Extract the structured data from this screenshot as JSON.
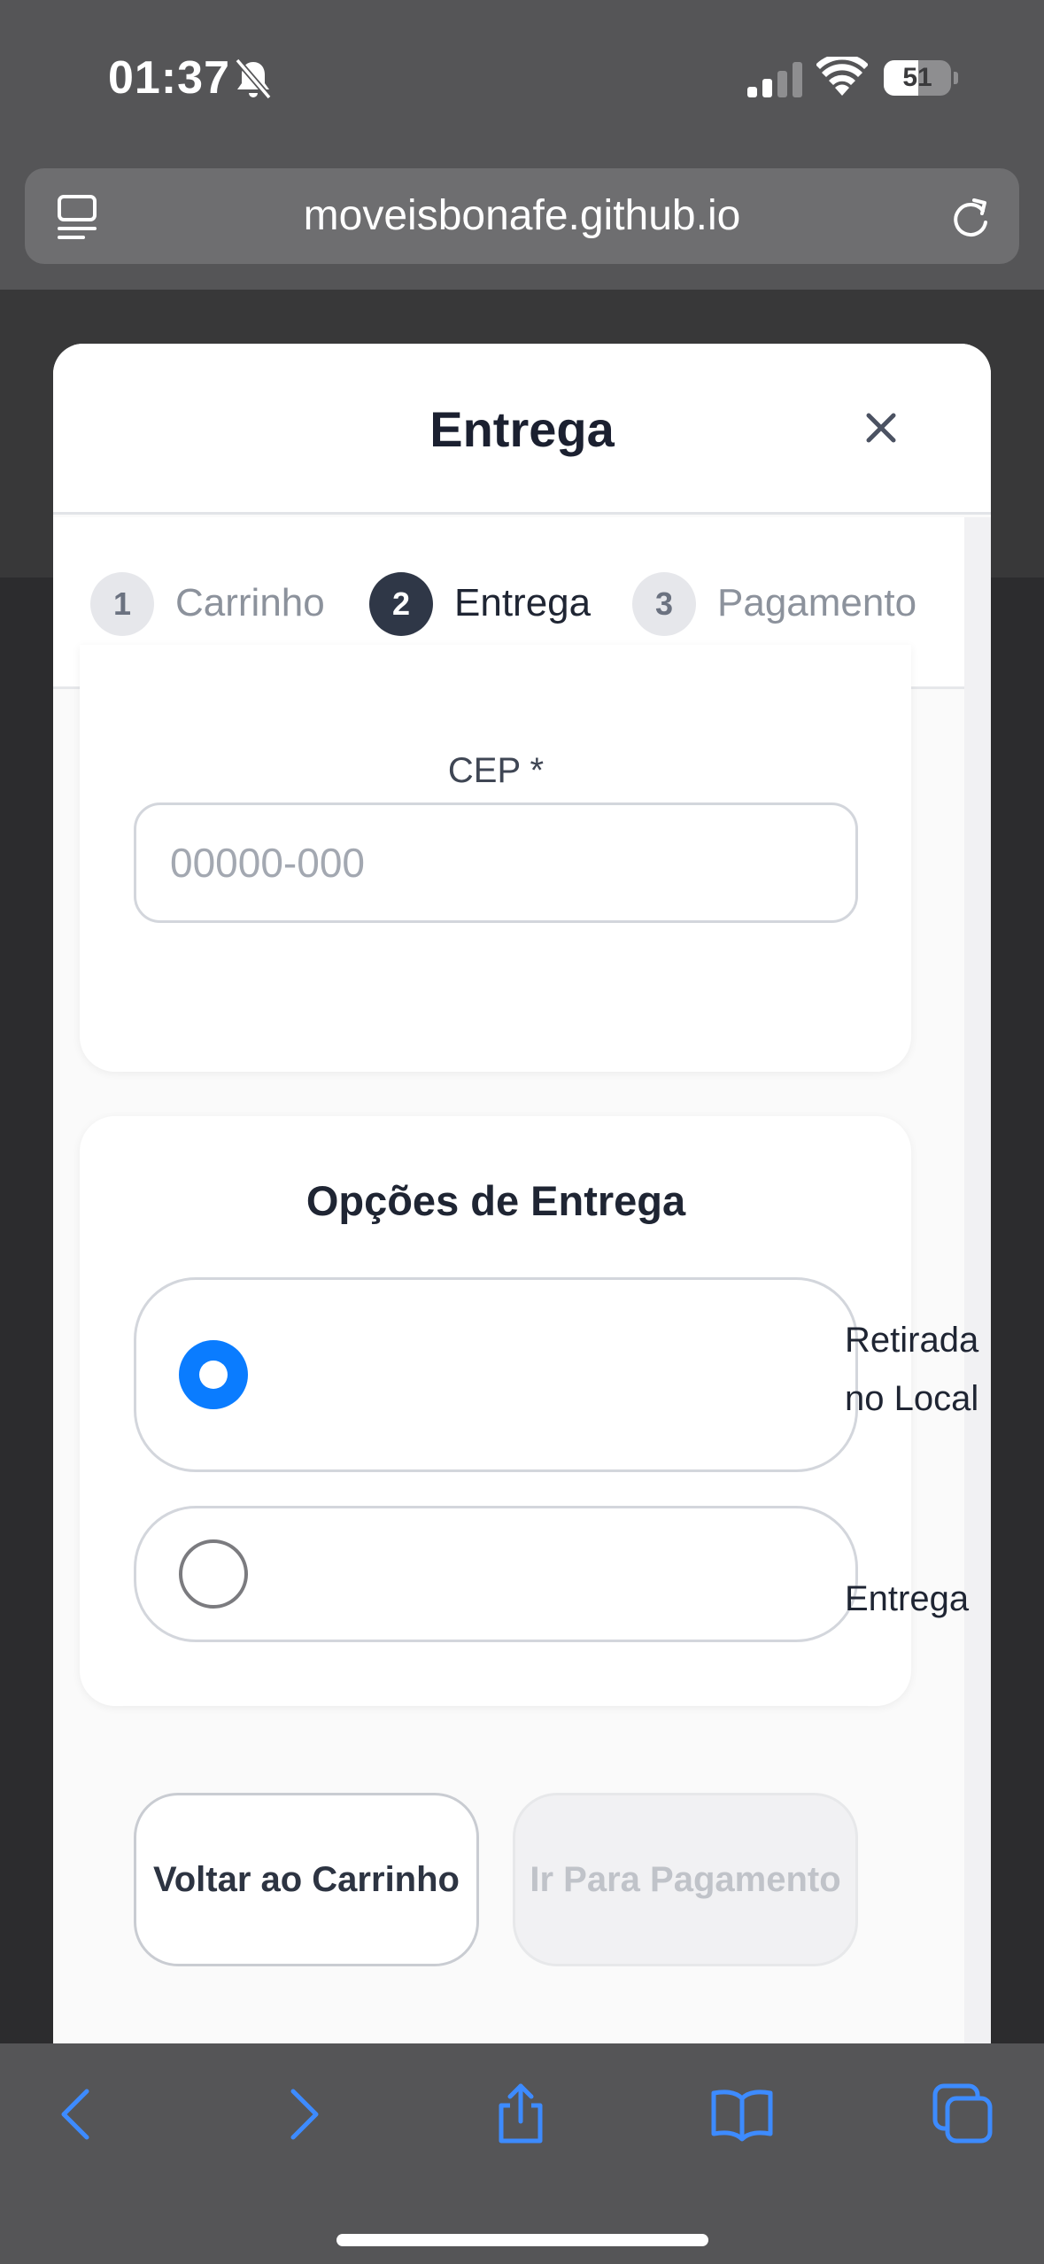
{
  "status_bar": {
    "time": "01:37",
    "battery_level": "51",
    "battery_fraction": 0.51,
    "icons": [
      "bell-slash-icon",
      "cellular-signal-icon",
      "wifi-icon",
      "battery-icon"
    ]
  },
  "browser": {
    "url": "moveisbonafe.github.io",
    "icons": [
      "reader-mode-icon",
      "reload-icon"
    ]
  },
  "modal": {
    "title": "Entrega",
    "close_icon": "close-icon",
    "steps": [
      {
        "number": "1",
        "label": "Carrinho",
        "active": false
      },
      {
        "number": "2",
        "label": "Entrega",
        "active": true
      },
      {
        "number": "3",
        "label": "Pagamento",
        "active": false
      }
    ],
    "cep": {
      "label": "CEP *",
      "placeholder": "00000-000",
      "value": ""
    },
    "delivery_options": {
      "title": "Opções de Entrega",
      "options": [
        {
          "label": "Retirada no Local",
          "selected": true
        },
        {
          "label": "Entrega",
          "selected": false
        }
      ]
    },
    "buttons": {
      "back": "Voltar ao Carrinho",
      "next": "Ir Para Pagamento"
    }
  },
  "toolbar": {
    "icons": [
      "back-icon",
      "forward-icon",
      "share-icon",
      "bookmarks-icon",
      "tabs-icon"
    ]
  },
  "colors": {
    "accent": "#0a7cff",
    "active_step": "#2f3747",
    "browser_chrome": "#555557"
  }
}
